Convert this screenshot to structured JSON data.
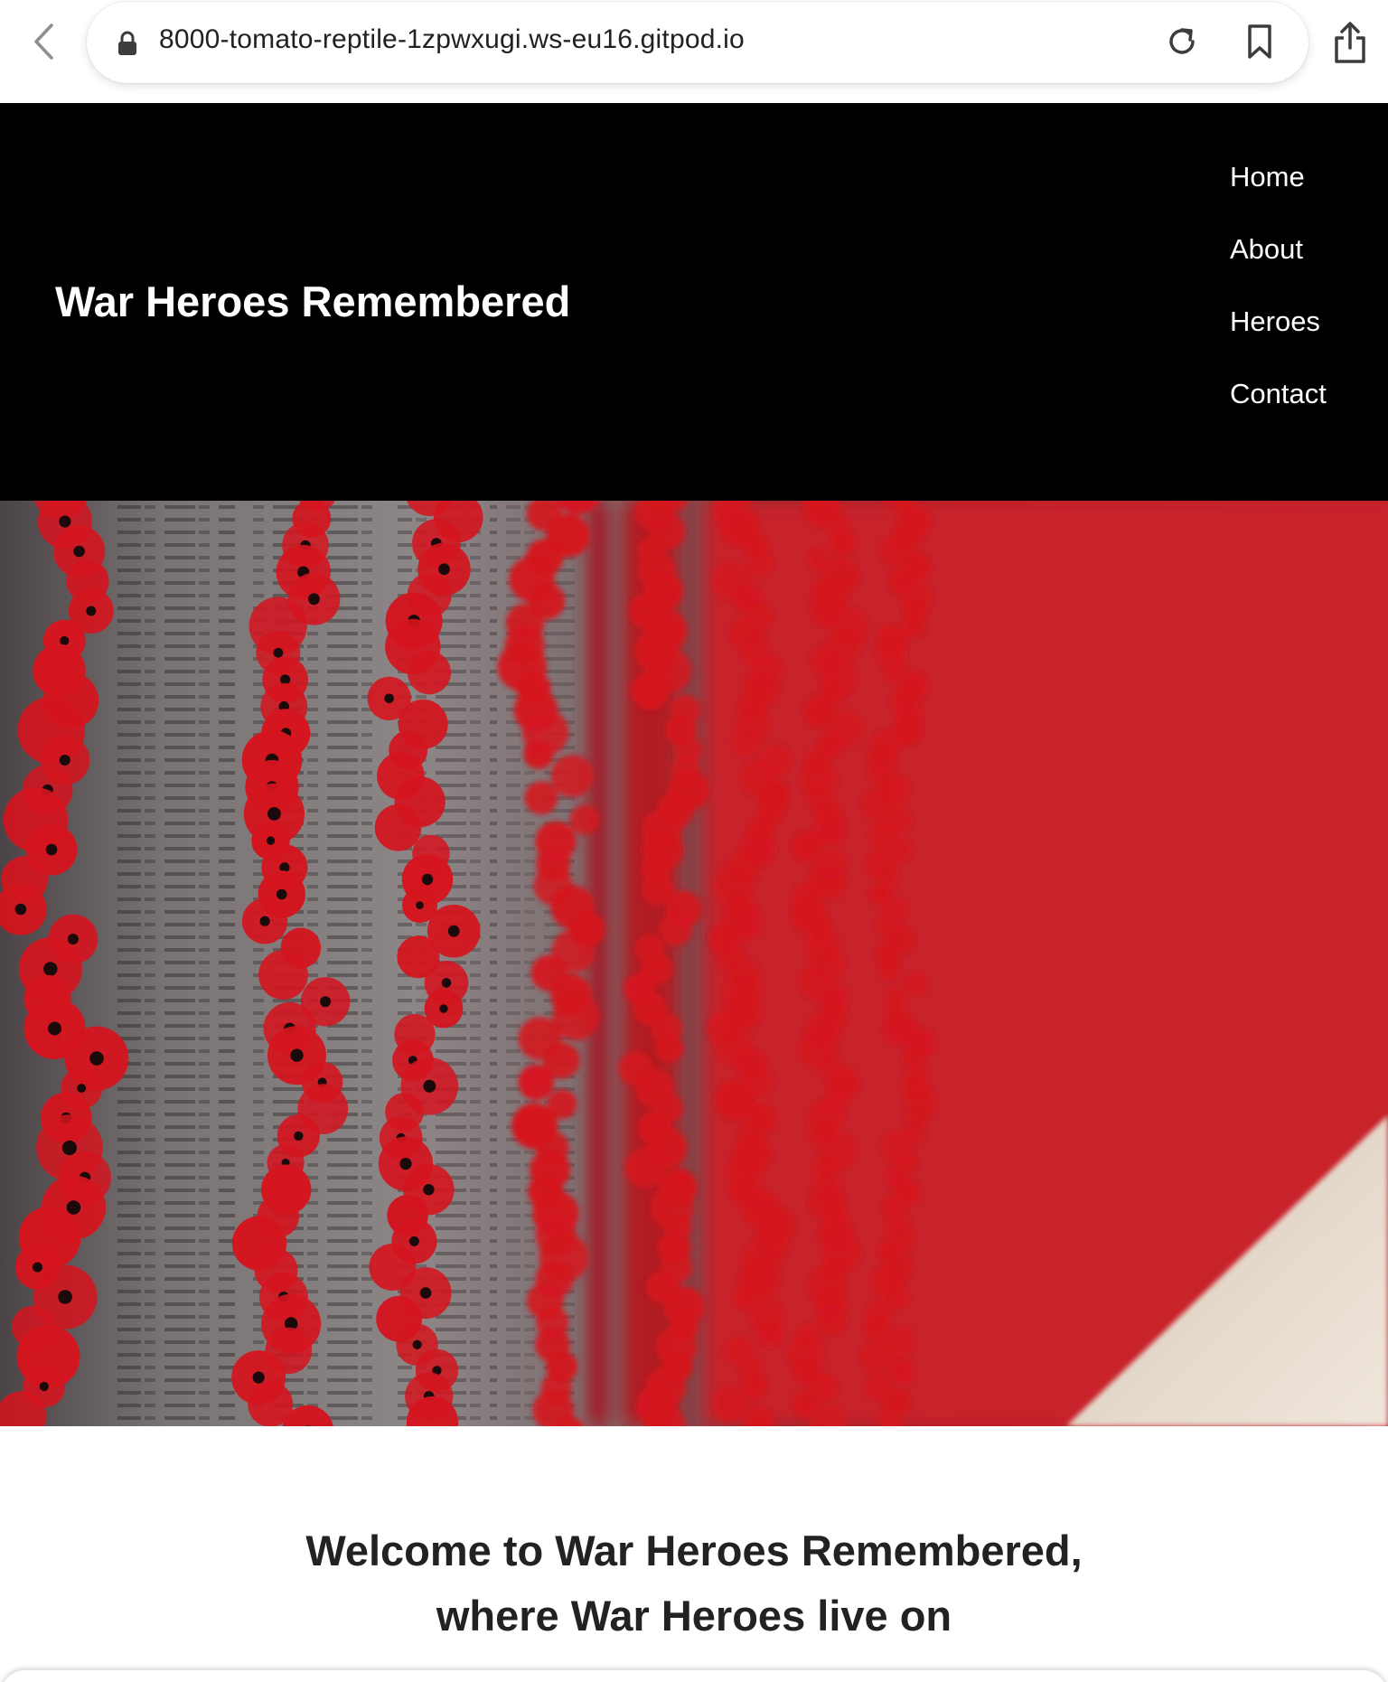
{
  "browser": {
    "url": "8000-tomato-reptile-1zpwxugi.ws-eu16.gitpod.io",
    "icons": [
      "back-chevron-icon",
      "lock-icon",
      "reload-icon",
      "bookmark-icon",
      "share-icon"
    ]
  },
  "site": {
    "title": "War Heroes Remembered",
    "nav": [
      {
        "label": "Home"
      },
      {
        "label": "About"
      },
      {
        "label": "Heroes"
      },
      {
        "label": "Contact"
      }
    ]
  },
  "hero": {
    "image": "poppies-on-memorial-wall"
  },
  "main": {
    "welcome_line1": "Welcome to War Heroes Remembered,",
    "welcome_line2": "where War Heroes live on"
  },
  "colors": {
    "header_bg": "#000000",
    "poppy_red": "#d4151f",
    "text_dark": "#222222"
  }
}
